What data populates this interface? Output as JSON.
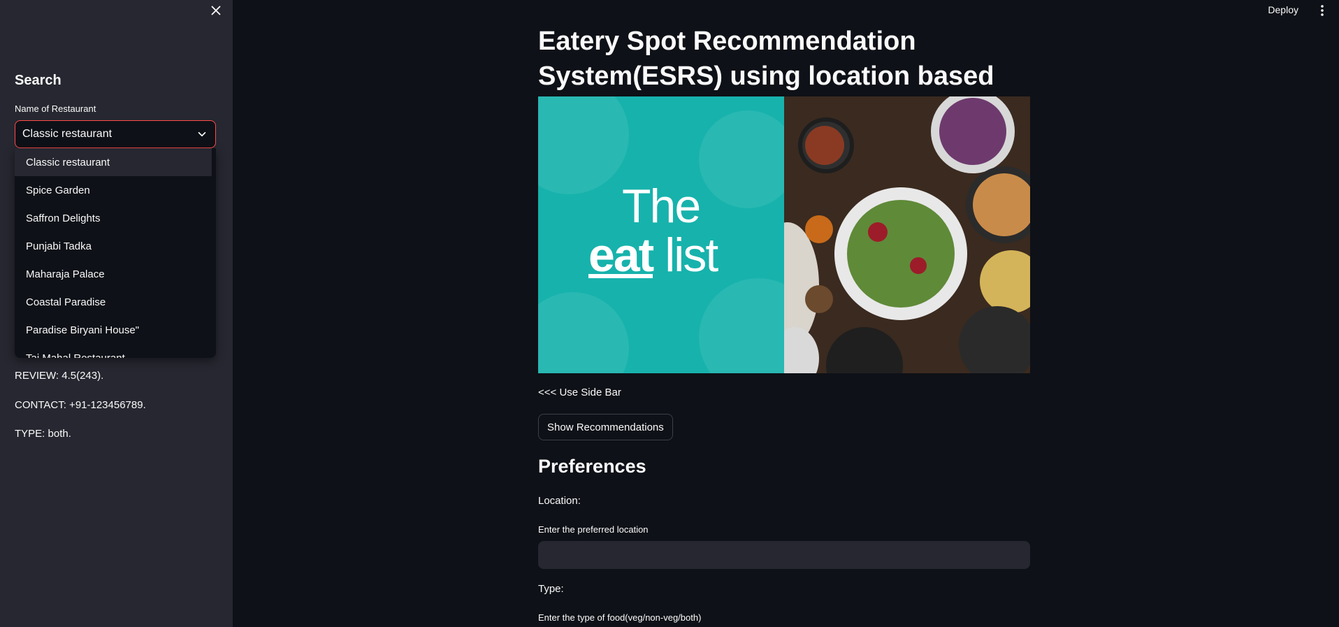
{
  "topbar": {
    "deploy_label": "Deploy"
  },
  "sidebar": {
    "heading": "Search",
    "field_label": "Name of Restaurant",
    "selected_value": "Classic restaurant",
    "options": [
      "Classic restaurant",
      "Spice Garden",
      "Saffron Delights",
      "Punjabi Tadka",
      "Maharaja Palace",
      "Coastal Paradise",
      "Paradise Biryani House\"",
      "Taj Mahal Restaurant"
    ],
    "info": {
      "review": "REVIEW: 4.5(243).",
      "contact": "CONTACT: +91-123456789.",
      "type": "TYPE: both."
    }
  },
  "main": {
    "title": "Eatery Spot Recommendation System(ESRS) using location based social networks(LBSNs)",
    "hero": {
      "logo_line1": "The",
      "logo_eat": "eat",
      "logo_list": "list"
    },
    "hint": "<<< Use Side Bar",
    "show_button": "Show Recommendations",
    "preferences_heading": "Preferences",
    "location_label": "Location:",
    "location_field_label": "Enter the preferred location",
    "location_value": "",
    "type_label": "Type:",
    "type_field_label": "Enter the type of food(veg/non-veg/both)"
  },
  "colors": {
    "accent": "#ff4b4b",
    "background": "#0e1117",
    "sidebar": "#262730",
    "hero_teal": "#17b2ac"
  }
}
